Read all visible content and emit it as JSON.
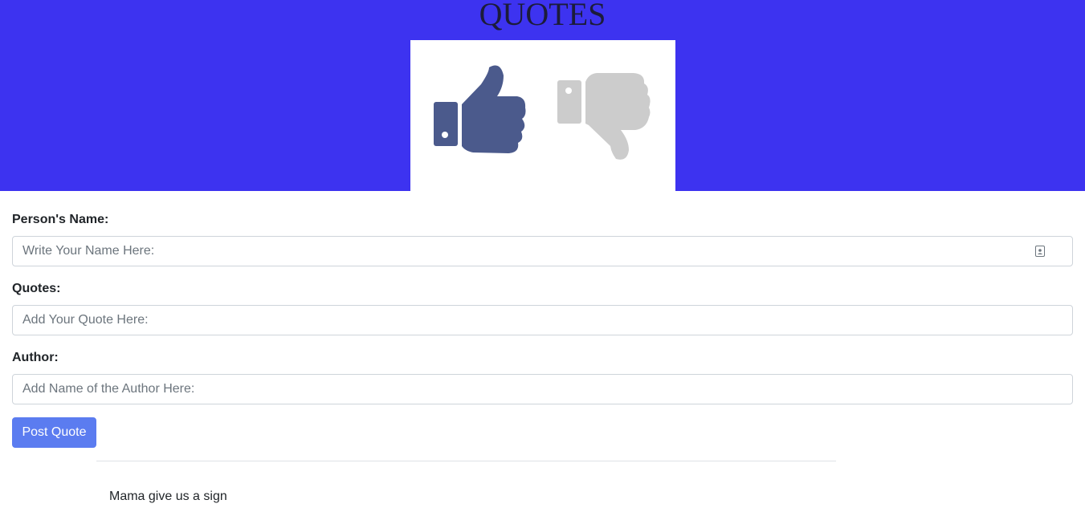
{
  "header": {
    "title": "QUOTES",
    "colors": {
      "background": "#3d33f0",
      "thumbs_up": "#4b5a8c",
      "thumbs_down": "#cccccc"
    },
    "image_icons": [
      "thumbs-up-icon",
      "thumbs-down-icon"
    ]
  },
  "form": {
    "name_label": "Person's Name:",
    "name_placeholder": "Write Your Name Here:",
    "name_value": "",
    "name_field_icon": "contact-card-icon",
    "quote_label": "Quotes:",
    "quote_placeholder": "Add Your Quote Here:",
    "quote_value": "",
    "author_label": "Author:",
    "author_placeholder": "Add Name of the Author Here:",
    "author_value": "",
    "submit_label": "Post Quote",
    "submit_color": "#5b7cf0"
  },
  "quotes": [
    {
      "text": "Mama give us a sign"
    }
  ]
}
